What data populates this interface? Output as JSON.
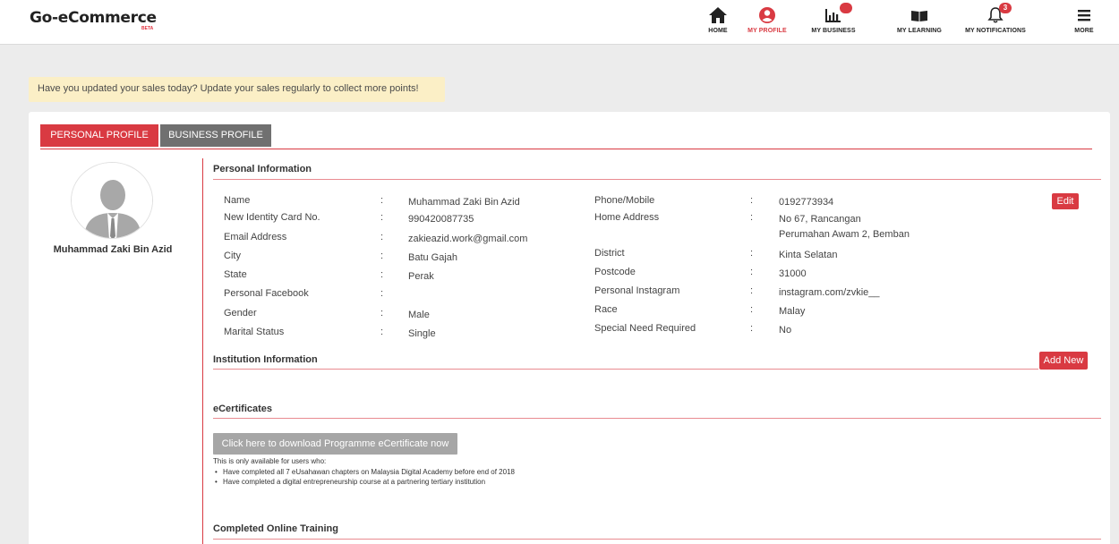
{
  "brand": {
    "name": "Go-eCommerce",
    "tag": "BETA"
  },
  "nav": [
    {
      "id": "home",
      "label": "HOME",
      "icon": "home-icon"
    },
    {
      "id": "profile",
      "label": "MY PROFILE",
      "icon": "user-icon",
      "active": true
    },
    {
      "id": "business",
      "label": "MY BUSINESS",
      "icon": "bar-chart-icon",
      "badge": ""
    },
    {
      "id": "learning",
      "label": "MY LEARNING",
      "icon": "book-icon"
    },
    {
      "id": "notifications",
      "label": "MY NOTIFICATIONS",
      "icon": "bell-icon",
      "badge": "3"
    },
    {
      "id": "more",
      "label": "MORE",
      "icon": "menu-icon"
    }
  ],
  "banner": {
    "text": "Have you updated your sales today? Update your sales regularly to collect more points!"
  },
  "tabs": {
    "personal": "PERSONAL PROFILE",
    "business": "BUSINESS PROFILE"
  },
  "sidebar": {
    "name": "Muhammad Zaki Bin Azid"
  },
  "personal_info": {
    "title": "Personal Information",
    "edit_label": "Edit",
    "separator": ":",
    "left": [
      {
        "label": "Name",
        "value": "Muhammad Zaki Bin Azid"
      },
      {
        "label": "New Identity Card No.",
        "value": "990420087735"
      },
      {
        "label": "Email Address",
        "value": "zakieazid.work@gmail.com"
      },
      {
        "label": "City",
        "value": "Batu Gajah"
      },
      {
        "label": "State",
        "value": "Perak"
      },
      {
        "label": "Personal Facebook",
        "value": ""
      },
      {
        "label": "Gender",
        "value": "Male"
      },
      {
        "label": "Marital Status",
        "value": "Single"
      }
    ],
    "right": [
      {
        "label": "Phone/Mobile",
        "value": "0192773934"
      },
      {
        "label": "Home Address",
        "value": "No 67, Rancangan",
        "value2": "Perumahan Awam 2, Bemban"
      },
      {
        "label": "District",
        "value": "Kinta Selatan"
      },
      {
        "label": "Postcode",
        "value": "31000"
      },
      {
        "label": "Personal Instagram",
        "value": "instagram.com/zvkie__"
      },
      {
        "label": "Race",
        "value": "Malay"
      },
      {
        "label": "Special Need Required",
        "value": "No"
      }
    ]
  },
  "institution": {
    "title": "Institution Information",
    "add_label": "Add New"
  },
  "ecert": {
    "title": "eCertificates",
    "button": "Click here to download Programme eCertificate now",
    "note": "This is only available for users who:",
    "items": [
      "Have completed all 7 eUsahawan chapters on Malaysia Digital Academy before end of 2018",
      "Have completed a digital entrepreneurship course at a partnering tertiary institution"
    ]
  },
  "training": {
    "title": "Completed Online Training"
  },
  "colors": {
    "accent": "#d93a42",
    "banner": "#fbefc6",
    "tab_inactive": "#707070",
    "button_disabled": "#a6a6a6"
  }
}
